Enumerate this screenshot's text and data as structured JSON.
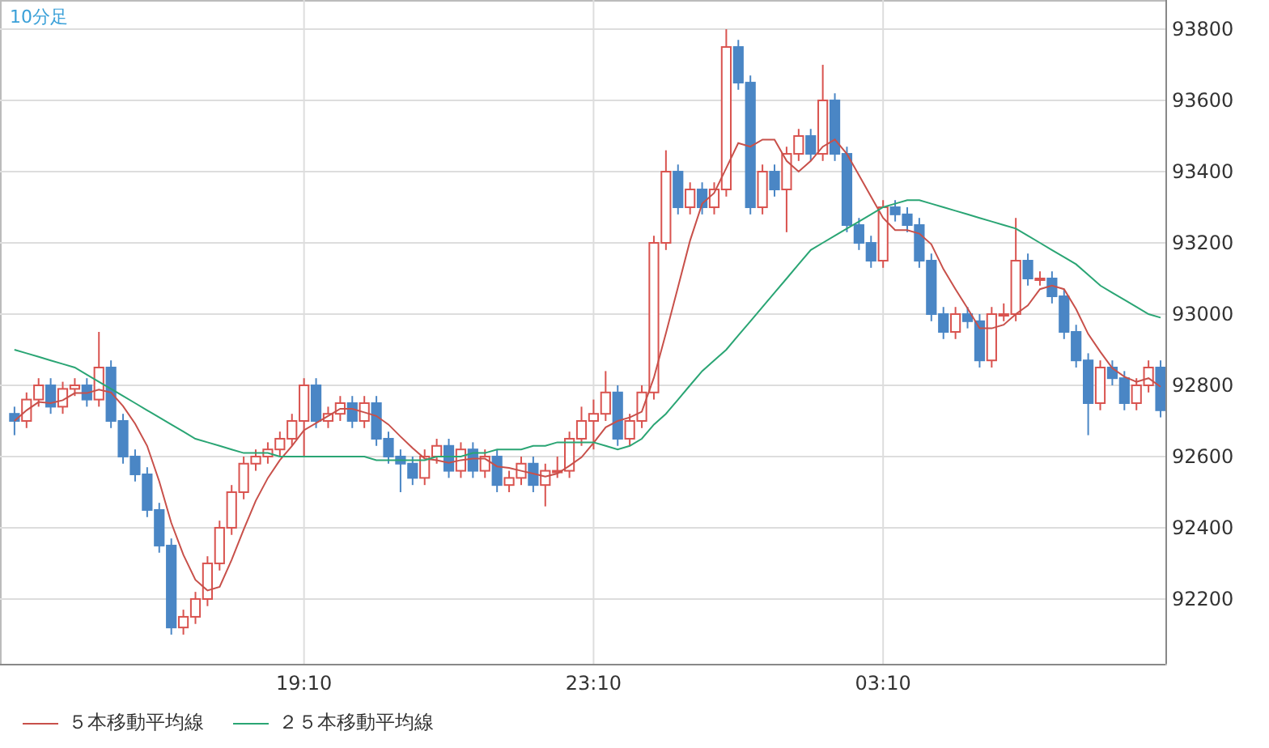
{
  "chart_data": {
    "type": "candlestick",
    "title": "10分足",
    "grid": true,
    "ylim": [
      92018,
      93882
    ],
    "yticks": [
      92200,
      92400,
      92600,
      92800,
      93000,
      93200,
      93400,
      93600,
      93800
    ],
    "categories": [
      null,
      null,
      null,
      null,
      null,
      null,
      null,
      null,
      null,
      null,
      null,
      null,
      null,
      null,
      null,
      null,
      null,
      null,
      null,
      null,
      null,
      null,
      null,
      null,
      "19:10",
      null,
      null,
      null,
      null,
      null,
      null,
      null,
      null,
      null,
      null,
      null,
      null,
      null,
      null,
      null,
      null,
      null,
      null,
      null,
      null,
      null,
      null,
      null,
      "23:10",
      null,
      null,
      null,
      null,
      null,
      null,
      null,
      null,
      null,
      null,
      null,
      null,
      null,
      null,
      null,
      null,
      null,
      null,
      null,
      null,
      null,
      null,
      null,
      "03:10",
      null,
      null,
      null,
      null,
      null,
      null,
      null,
      null,
      null,
      null,
      null,
      null,
      null,
      null,
      null,
      null,
      null,
      null,
      null,
      null,
      null,
      null,
      null
    ],
    "ohlc": [
      [
        92720,
        92740,
        92660,
        92700
      ],
      [
        92700,
        92780,
        92680,
        92760
      ],
      [
        92760,
        92820,
        92740,
        92800
      ],
      [
        92800,
        92820,
        92720,
        92740
      ],
      [
        92740,
        92810,
        92720,
        92790
      ],
      [
        92790,
        92820,
        92770,
        92800
      ],
      [
        92800,
        92820,
        92740,
        92760
      ],
      [
        92760,
        92950,
        92740,
        92850
      ],
      [
        92850,
        92870,
        92680,
        92700
      ],
      [
        92700,
        92720,
        92580,
        92600
      ],
      [
        92600,
        92620,
        92530,
        92550
      ],
      [
        92550,
        92570,
        92430,
        92450
      ],
      [
        92450,
        92470,
        92330,
        92350
      ],
      [
        92350,
        92370,
        92100,
        92120
      ],
      [
        92120,
        92170,
        92100,
        92150
      ],
      [
        92150,
        92220,
        92130,
        92200
      ],
      [
        92200,
        92320,
        92180,
        92300
      ],
      [
        92300,
        92420,
        92280,
        92400
      ],
      [
        92400,
        92520,
        92380,
        92500
      ],
      [
        92500,
        92600,
        92480,
        92580
      ],
      [
        92580,
        92620,
        92560,
        92600
      ],
      [
        92600,
        92640,
        92580,
        92620
      ],
      [
        92620,
        92670,
        92600,
        92650
      ],
      [
        92650,
        92720,
        92630,
        92700
      ],
      [
        92700,
        92820,
        92600,
        92800
      ],
      [
        92800,
        92820,
        92680,
        92700
      ],
      [
        92700,
        92740,
        92680,
        92720
      ],
      [
        92720,
        92770,
        92700,
        92750
      ],
      [
        92750,
        92770,
        92680,
        92700
      ],
      [
        92700,
        92770,
        92680,
        92750
      ],
      [
        92750,
        92770,
        92630,
        92650
      ],
      [
        92650,
        92670,
        92580,
        92600
      ],
      [
        92600,
        92620,
        92500,
        92580
      ],
      [
        92580,
        92600,
        92520,
        92540
      ],
      [
        92540,
        92620,
        92520,
        92600
      ],
      [
        92600,
        92650,
        92580,
        92630
      ],
      [
        92630,
        92650,
        92540,
        92560
      ],
      [
        92560,
        92640,
        92540,
        92620
      ],
      [
        92620,
        92640,
        92540,
        92560
      ],
      [
        92560,
        92620,
        92540,
        92600
      ],
      [
        92600,
        92620,
        92500,
        92520
      ],
      [
        92520,
        92560,
        92500,
        92540
      ],
      [
        92540,
        92600,
        92520,
        92580
      ],
      [
        92580,
        92600,
        92500,
        92520
      ],
      [
        92520,
        92580,
        92460,
        92560
      ],
      [
        92560,
        92600,
        92540,
        92560
      ],
      [
        92560,
        92670,
        92540,
        92650
      ],
      [
        92650,
        92740,
        92630,
        92700
      ],
      [
        92700,
        92760,
        92620,
        92720
      ],
      [
        92720,
        92840,
        92700,
        92780
      ],
      [
        92780,
        92800,
        92630,
        92650
      ],
      [
        92650,
        92720,
        92630,
        92700
      ],
      [
        92700,
        92800,
        92680,
        92780
      ],
      [
        92780,
        93220,
        92760,
        93200
      ],
      [
        93200,
        93460,
        93180,
        93400
      ],
      [
        93400,
        93420,
        93280,
        93300
      ],
      [
        93300,
        93370,
        93280,
        93350
      ],
      [
        93350,
        93370,
        93280,
        93300
      ],
      [
        93300,
        93370,
        93280,
        93350
      ],
      [
        93350,
        93800,
        93330,
        93750
      ],
      [
        93750,
        93770,
        93630,
        93650
      ],
      [
        93650,
        93670,
        93280,
        93300
      ],
      [
        93300,
        93420,
        93280,
        93400
      ],
      [
        93400,
        93420,
        93330,
        93350
      ],
      [
        93350,
        93470,
        93230,
        93450
      ],
      [
        93450,
        93520,
        93430,
        93500
      ],
      [
        93500,
        93520,
        93430,
        93450
      ],
      [
        93450,
        93700,
        93430,
        93600
      ],
      [
        93600,
        93620,
        93430,
        93450
      ],
      [
        93450,
        93470,
        93230,
        93250
      ],
      [
        93250,
        93270,
        93180,
        93200
      ],
      [
        93200,
        93220,
        93130,
        93150
      ],
      [
        93150,
        93320,
        93130,
        93300
      ],
      [
        93300,
        93320,
        93260,
        93280
      ],
      [
        93280,
        93300,
        93230,
        93250
      ],
      [
        93250,
        93270,
        93130,
        93150
      ],
      [
        93150,
        93170,
        92980,
        93000
      ],
      [
        93000,
        93020,
        92930,
        92950
      ],
      [
        92950,
        93020,
        92930,
        93000
      ],
      [
        93000,
        93020,
        92960,
        92980
      ],
      [
        92980,
        93000,
        92850,
        92870
      ],
      [
        92870,
        93020,
        92850,
        93000
      ],
      [
        93000,
        93030,
        92980,
        93000
      ],
      [
        93000,
        93270,
        92980,
        93150
      ],
      [
        93150,
        93170,
        93080,
        93100
      ],
      [
        93100,
        93120,
        93080,
        93100
      ],
      [
        93100,
        93120,
        93030,
        93050
      ],
      [
        93050,
        93070,
        92930,
        92950
      ],
      [
        92950,
        92970,
        92850,
        92870
      ],
      [
        92870,
        92890,
        92660,
        92750
      ],
      [
        92750,
        92870,
        92730,
        92850
      ],
      [
        92850,
        92870,
        92800,
        92820
      ],
      [
        92820,
        92840,
        92730,
        92750
      ],
      [
        92750,
        92820,
        92730,
        92800
      ],
      [
        92800,
        92870,
        92780,
        92850
      ],
      [
        92850,
        92870,
        92710,
        92730
      ]
    ],
    "series": [
      {
        "type": "line",
        "name": "５本移動平均線",
        "color": "#c8504a",
        "values": [
          92700,
          92730,
          92753,
          92750,
          92758,
          92778,
          92778,
          92788,
          92780,
          92742,
          92692,
          92630,
          92530,
          92414,
          92324,
          92254,
          92224,
          92234,
          92310,
          92396,
          92476,
          92540,
          92590,
          92630,
          92674,
          92694,
          92714,
          92734,
          92734,
          92724,
          92714,
          92690,
          92656,
          92624,
          92594,
          92590,
          92582,
          92590,
          92594,
          92594,
          92572,
          92568,
          92560,
          92552,
          92544,
          92552,
          92574,
          92598,
          92638,
          92682,
          92700,
          92710,
          92726,
          92822,
          92946,
          93076,
          93206,
          93310,
          93340,
          93410,
          93480,
          93470,
          93490,
          93490,
          93430,
          93400,
          93430,
          93470,
          93490,
          93450,
          93390,
          93330,
          93270,
          93236,
          93236,
          93226,
          93196,
          93126,
          93070,
          93016,
          92960,
          92960,
          92970,
          93000,
          93024,
          93070,
          93080,
          93070,
          93014,
          92944,
          92894,
          92848,
          92824,
          92810,
          92820,
          92796
        ]
      },
      {
        "type": "line",
        "name": "２５本移動平均線",
        "color": "#2aa574",
        "values": [
          92900,
          92890,
          92880,
          92870,
          92860,
          92850,
          92830,
          92810,
          92790,
          92770,
          92750,
          92730,
          92710,
          92690,
          92670,
          92650,
          92640,
          92630,
          92620,
          92610,
          92610,
          92610,
          92600,
          92600,
          92600,
          92600,
          92600,
          92600,
          92600,
          92600,
          92590,
          92590,
          92590,
          92590,
          92590,
          92600,
          92600,
          92600,
          92610,
          92610,
          92620,
          92620,
          92620,
          92630,
          92630,
          92640,
          92640,
          92640,
          92640,
          92630,
          92620,
          92630,
          92650,
          92690,
          92720,
          92760,
          92800,
          92840,
          92870,
          92900,
          92940,
          92980,
          93020,
          93060,
          93100,
          93140,
          93180,
          93200,
          93220,
          93240,
          93260,
          93280,
          93300,
          93310,
          93320,
          93320,
          93310,
          93300,
          93290,
          93280,
          93270,
          93260,
          93250,
          93240,
          93220,
          93200,
          93180,
          93160,
          93140,
          93110,
          93080,
          93060,
          93040,
          93020,
          93000,
          92990
        ]
      }
    ]
  }
}
